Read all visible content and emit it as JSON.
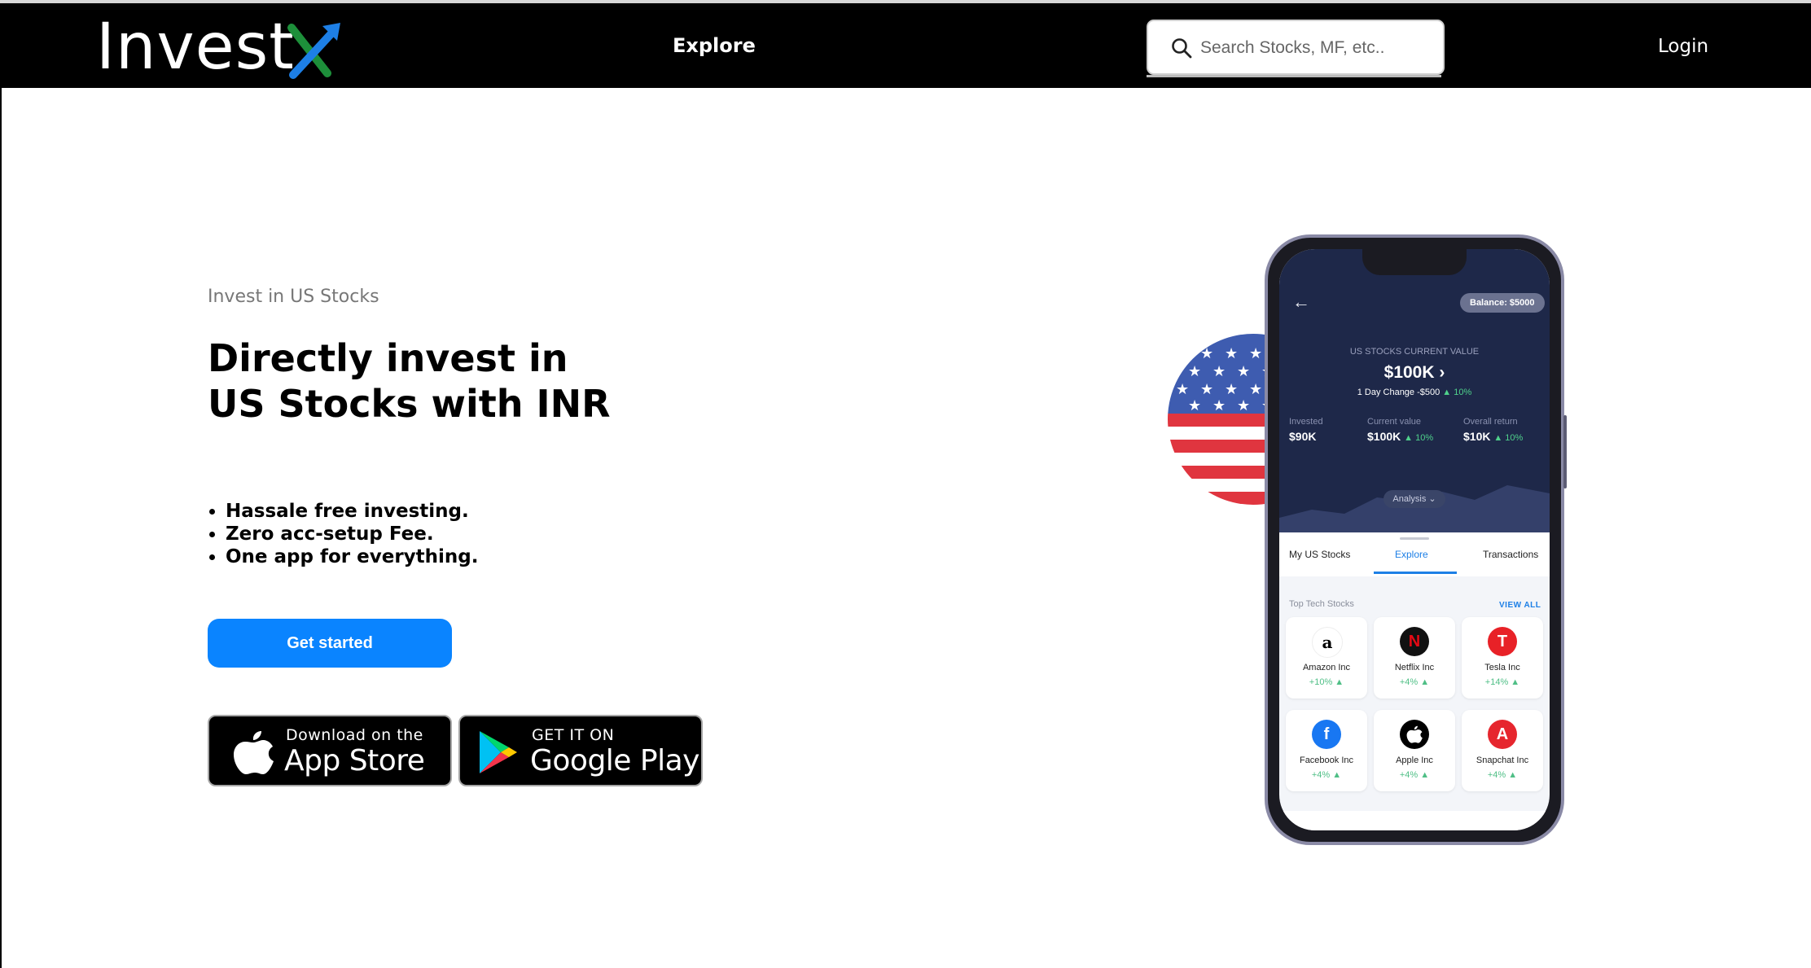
{
  "navbar": {
    "logo_text": "Invest",
    "explore_label": "Explore",
    "search_placeholder": "Search Stocks, MF, etc..",
    "login_label": "Login"
  },
  "hero": {
    "eyebrow": "Invest in US Stocks",
    "headline_line1": "Directly invest in",
    "headline_line2": "US Stocks with INR",
    "features": [
      "Hassale free investing.",
      "Zero acc-setup Fee.",
      "One app for everything."
    ],
    "cta_label": "Get started"
  },
  "stores": {
    "apple_small": "Download on the",
    "apple_big": "App Store",
    "google_small": "GET IT ON",
    "google_big": "Google Play"
  },
  "phone": {
    "balance": "Balance: $5000",
    "current_value_label": "US STOCKS CURRENT VALUE",
    "current_value": "$100K",
    "day_change": "1 Day Change -$500",
    "day_change_pct": "▲ 10%",
    "stats": [
      {
        "label": "Invested",
        "value": "$90K",
        "pct": ""
      },
      {
        "label": "Current value",
        "value": "$100K",
        "pct": "▲ 10%"
      },
      {
        "label": "Overall return",
        "value": "$10K",
        "pct": "▲ 10%"
      }
    ],
    "analysis_label": "Analysis ⌄",
    "tabs": [
      "My US Stocks",
      "Explore",
      "Transactions"
    ],
    "section_label": "Top Tech Stocks",
    "view_all": "VIEW ALL",
    "stocks": [
      {
        "name": "Amazon Inc",
        "change": "+10% ▲",
        "symbol": "a"
      },
      {
        "name": "Netflix Inc",
        "change": "+4% ▲",
        "symbol": "N"
      },
      {
        "name": "Tesla Inc",
        "change": "+14% ▲",
        "symbol": "T"
      },
      {
        "name": "Facebook Inc",
        "change": "+4% ▲",
        "symbol": "f"
      },
      {
        "name": "Apple Inc",
        "change": "+4% ▲",
        "symbol": ""
      },
      {
        "name": "Snapchat Inc",
        "change": "+4% ▲",
        "symbol": "A"
      }
    ]
  },
  "colors": {
    "navbar_bg": "#000000",
    "accent_blue": "#0a84ff",
    "phone_header_bg": "#1e2849",
    "positive_green": "#4fd18b"
  }
}
